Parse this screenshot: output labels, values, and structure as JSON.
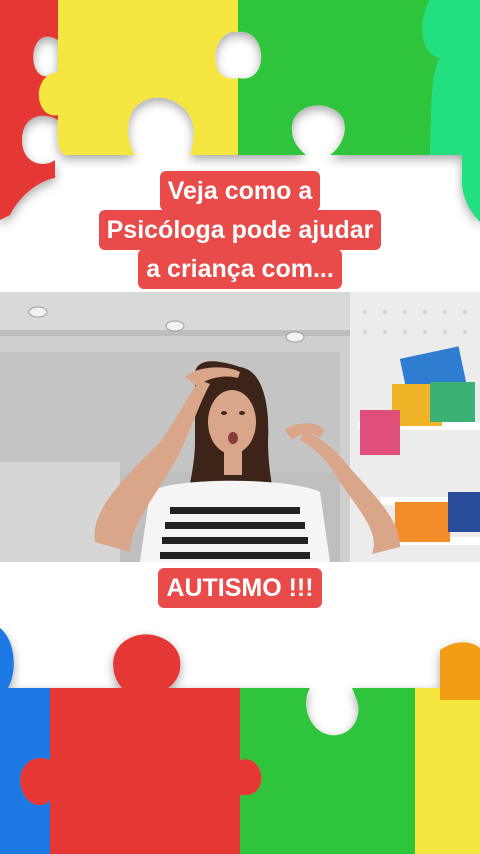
{
  "caption": {
    "top_lines": [
      "Veja como a",
      "Psicóloga pode ajudar",
      "a criança com..."
    ],
    "bottom": "AUTISMO !!!"
  },
  "colors": {
    "red": "#e53935",
    "yellow": "#f5e640",
    "green": "#2fc43b",
    "mint": "#22e07f",
    "blue": "#1e78e3",
    "caption_bg": "#e94b4b",
    "caption_text": "#ffffff"
  },
  "icons": {
    "puzzle": "puzzle-piece-icon",
    "shelf": "bookshelf-icon",
    "speaker": "woman-speaker-icon"
  }
}
